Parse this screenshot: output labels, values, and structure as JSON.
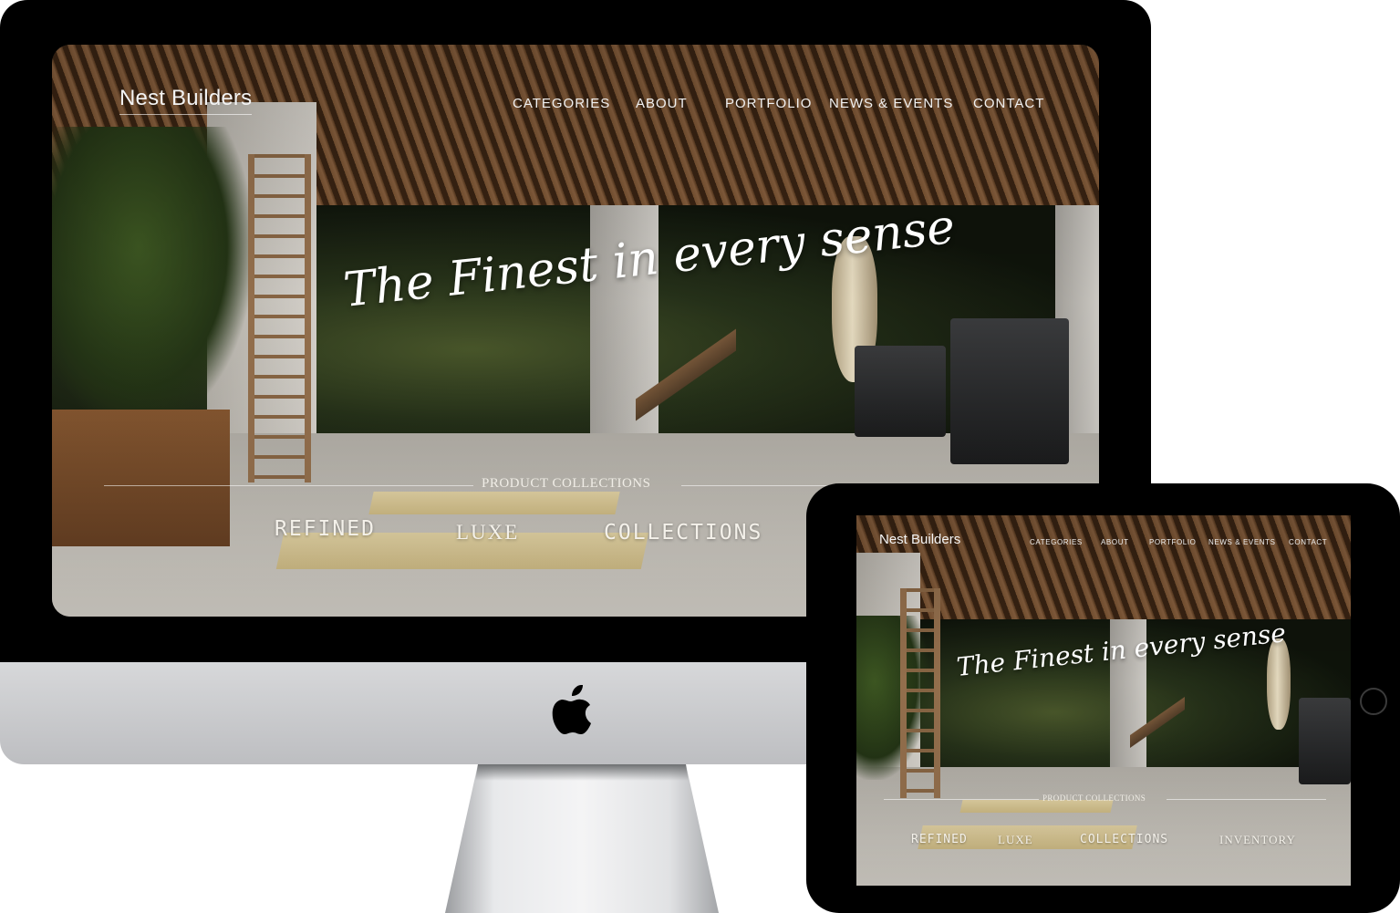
{
  "site": {
    "brand": "Nest Builders",
    "nav": [
      "CATEGORIES",
      "ABOUT",
      "PORTFOLIO",
      "NEWS & EVENTS",
      "CONTACT"
    ],
    "tagline": "The Finest in every sense",
    "section_label": "PRODUCT COLLECTIONS",
    "desktop_collections": [
      "REFINED",
      "LUXE",
      "COLLECTIONS"
    ],
    "tablet_collections": [
      "REFINED",
      "LUXE",
      "COLLECTIONS",
      "INVENTORY"
    ]
  },
  "icons": {
    "device_logo": "apple-logo-icon",
    "tablet_button": "home-button-icon"
  }
}
